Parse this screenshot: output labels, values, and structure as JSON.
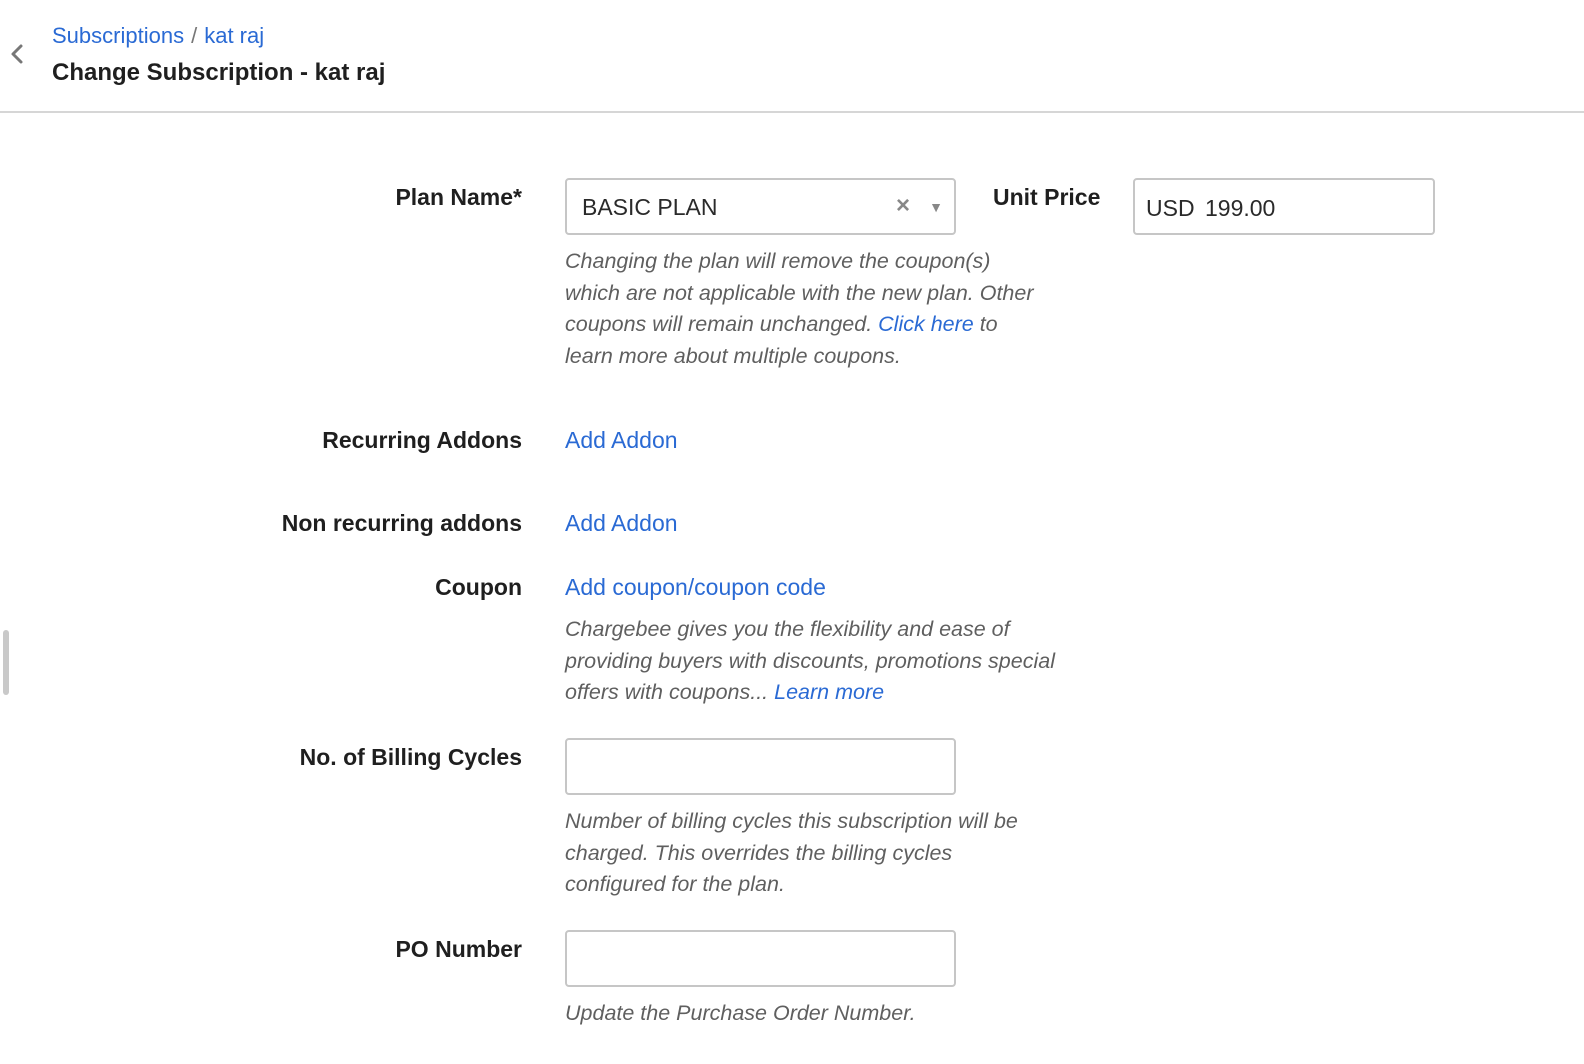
{
  "header": {
    "breadcrumb": {
      "parent": "Subscriptions",
      "separator": "/",
      "current": "kat raj"
    },
    "title": "Change Subscription - kat raj",
    "back_icon": "chevron-left-icon"
  },
  "form": {
    "plan": {
      "label": "Plan Name*",
      "value": "BASIC PLAN",
      "clear_glyph": "×",
      "caret_glyph": "▼",
      "help_text_1": "Changing the plan will remove the coupon(s) which are not applicable with the new plan. Other coupons will remain unchanged. ",
      "help_link": "Click here",
      "help_text_2": " to learn more about multiple coupons."
    },
    "unit_price": {
      "label": "Unit Price",
      "currency": "USD",
      "value": "199.00"
    },
    "recurring_addons": {
      "label": "Recurring Addons",
      "action": "Add Addon"
    },
    "non_recurring_addons": {
      "label": "Non recurring addons",
      "action": "Add Addon"
    },
    "coupon": {
      "label": "Coupon",
      "action": "Add coupon/coupon code",
      "help_text": "Chargebee gives you the flexibility and ease of providing buyers with discounts, promotions special offers with coupons... ",
      "help_link": "Learn more"
    },
    "billing_cycles": {
      "label": "No. of Billing Cycles",
      "value": "",
      "help_text": "Number of billing cycles this subscription will be charged. This overrides the billing cycles configured for the plan."
    },
    "po_number": {
      "label": "PO Number",
      "value": "",
      "help_text": "Update the Purchase Order Number."
    }
  },
  "colors": {
    "link": "#2a6ad4",
    "label": "#1f1f1f",
    "help": "#5f5f5f",
    "border": "#c6c6c6"
  }
}
